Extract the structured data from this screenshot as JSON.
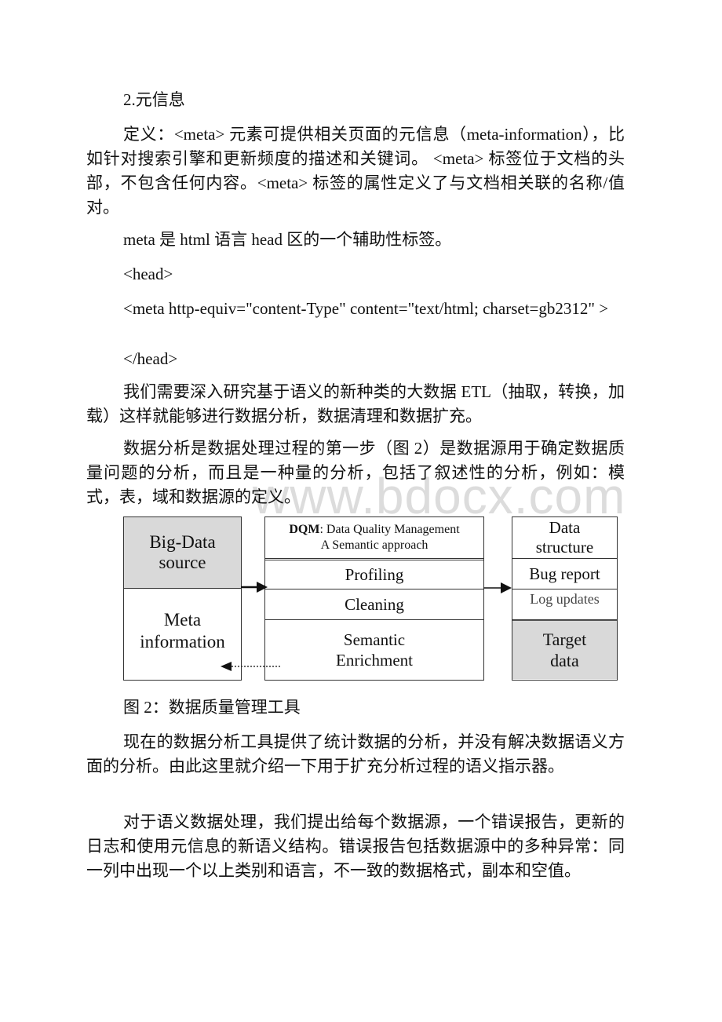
{
  "document": {
    "section_heading": "2.元信息",
    "paragraphs": {
      "definition": "定义：<meta> 元素可提供相关页面的元信息（meta-information），比如针对搜索引擎和更新频度的描述和关键词。 <meta> 标签位于文档的头部，不包含任何内容。<meta> 标签的属性定义了与文档相关联的名称/值对。",
      "meta_intro": "meta 是 html 语言 head 区的一个辅助性标签。",
      "code_head_open": "<head>",
      "code_meta": "<meta http-equiv=\"content-Type\" content=\"text/html; charset=gb2312\" >",
      "code_head_close": "</head>",
      "etl": "我们需要深入研究基于语义的新种类的大数据 ETL（抽取，转换，加载）这样就能够进行数据分析，数据清理和数据扩充。",
      "profiling": "数据分析是数据处理过程的第一步（图 2）是数据源用于确定数据质量问题的分析，而且是一种量的分析，包括了叙述性的分析，例如：模式，表，域和数据源的定义。",
      "current_tools": "现在的数据分析工具提供了统计数据的分析，并没有解决数据语义方面的分析。由此这里就介绍一下用于扩充分析过程的语义指示器。",
      "semantic_processing": "对于语义数据处理，我们提出给每个数据源，一个错误报告，更新的日志和使用元信息的新语义结构。错误报告包括数据源中的多种异常：同一列中出现一个以上类别和语言，不一致的数据格式，副本和空值。"
    },
    "figure_caption": "图 2：数据质量管理工具",
    "watermark": "www.bdocx.com"
  },
  "diagram": {
    "left_box": {
      "top_label": "Big-Data source",
      "bottom_label": "Meta information",
      "top_fill": "#d9d9d9"
    },
    "middle_box": {
      "header_bold": "DQM",
      "header_rest": ": Data Quality Management",
      "header_line2": "A Semantic approach",
      "rows": [
        "Profiling",
        "Cleaning",
        "Semantic Enrichment"
      ]
    },
    "right_box": {
      "rows": [
        "Data structure",
        "Bug report",
        "Log updates",
        "Target data"
      ],
      "bottom_fill": "#d9d9d9"
    },
    "arrows": [
      {
        "from": "left_box",
        "to": "middle_box",
        "style": "solid"
      },
      {
        "from": "middle_box",
        "to": "right_box",
        "style": "solid"
      },
      {
        "from": "middle_box",
        "to": "left_box",
        "style": "dotted"
      }
    ]
  }
}
